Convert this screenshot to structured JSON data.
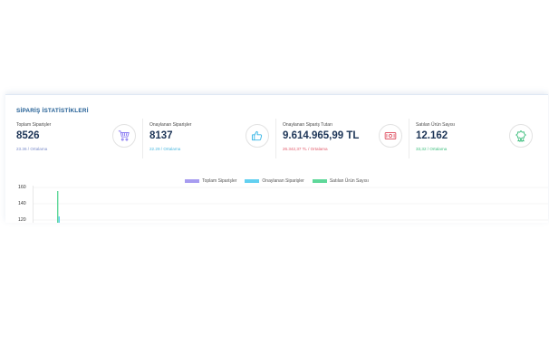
{
  "panel": {
    "title": "SİPARİŞ İSTATİSTİKLERİ"
  },
  "stats": [
    {
      "label": "Toplam Siparişler",
      "value": "8526",
      "average": "23.36 / Ortalama",
      "avg_color": "#7b8cc9",
      "icon": "shopping-cart-icon",
      "icon_color": "#8b7cf2"
    },
    {
      "label": "Onaylanan Siparişler",
      "value": "8137",
      "average": "22.29 / Ortalama",
      "avg_color": "#4ab8df",
      "icon": "thumbs-up-icon",
      "icon_color": "#38b6e6"
    },
    {
      "label": "Onaylanan Sipariş Tutarı",
      "value": "9.614.965,99 TL",
      "average": "26.342,37 TL / Ortalama",
      "avg_color": "#e15b6b",
      "icon": "money-bill-icon",
      "icon_color": "#e15b6b"
    },
    {
      "label": "Satılan Ürün Sayısı",
      "value": "12.162",
      "average": "33,32 / Ortalama",
      "avg_color": "#3fbf7f",
      "icon": "star-badge-icon",
      "icon_color": "#3fbf7f"
    }
  ],
  "legend": [
    {
      "label": "Toplam Siparişler",
      "color": "#a79cf0"
    },
    {
      "label": "Onaylanan Siparişler",
      "color": "#62d0f0"
    },
    {
      "label": "Satılan Ürün Sayısı",
      "color": "#5fd89a"
    }
  ],
  "chart_data": {
    "type": "bar",
    "y_ticks": [
      "160",
      "140",
      "120"
    ],
    "ylim": [
      120,
      160
    ],
    "grid": true
  }
}
